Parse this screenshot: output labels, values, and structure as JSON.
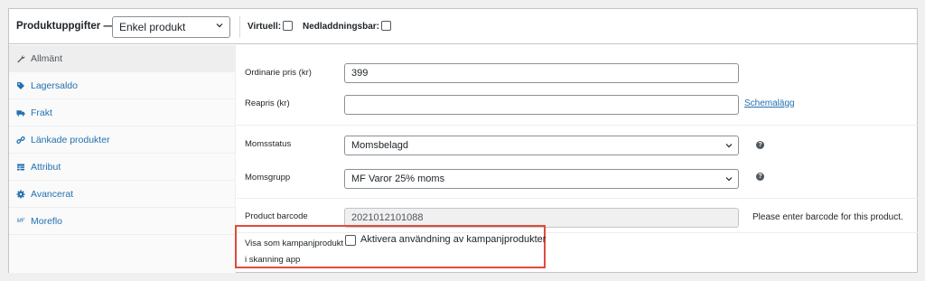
{
  "header": {
    "title": "Produktuppgifter —",
    "product_type": "Enkel produkt",
    "virtual_label": "Virtuell:",
    "downloadable_label": "Nedladdningsbar:"
  },
  "sidebar": {
    "items": [
      {
        "label": "Allmänt",
        "icon": "wrench-icon"
      },
      {
        "label": "Lagersaldo",
        "icon": "tag-icon"
      },
      {
        "label": "Frakt",
        "icon": "truck-icon"
      },
      {
        "label": "Länkade produkter",
        "icon": "link-icon"
      },
      {
        "label": "Attribut",
        "icon": "table-icon"
      },
      {
        "label": "Avancerat",
        "icon": "gear-icon"
      },
      {
        "label": "Moreflo",
        "icon": "mf-icon"
      }
    ]
  },
  "general": {
    "regular_price": {
      "label": "Ordinarie pris (kr)",
      "value": "399"
    },
    "sale_price": {
      "label": "Reapris (kr)",
      "value": "",
      "schedule_link": "Schemalägg"
    },
    "tax_status": {
      "label": "Momsstatus",
      "value": "Momsbelagd"
    },
    "tax_class": {
      "label": "Momsgrupp",
      "value": "MF Varor 25% moms"
    },
    "barcode": {
      "label": "Product barcode",
      "value": "2021012101088",
      "note": "Please enter barcode for this product."
    },
    "campaign": {
      "label_line1": "Visa som kampanjprodukt",
      "label_line2": "i skanning app",
      "checkbox_text": "Aktivera användning av kampanjprodukter"
    }
  },
  "colors": {
    "accent": "#2271b1",
    "highlight": "#e14b3b"
  }
}
